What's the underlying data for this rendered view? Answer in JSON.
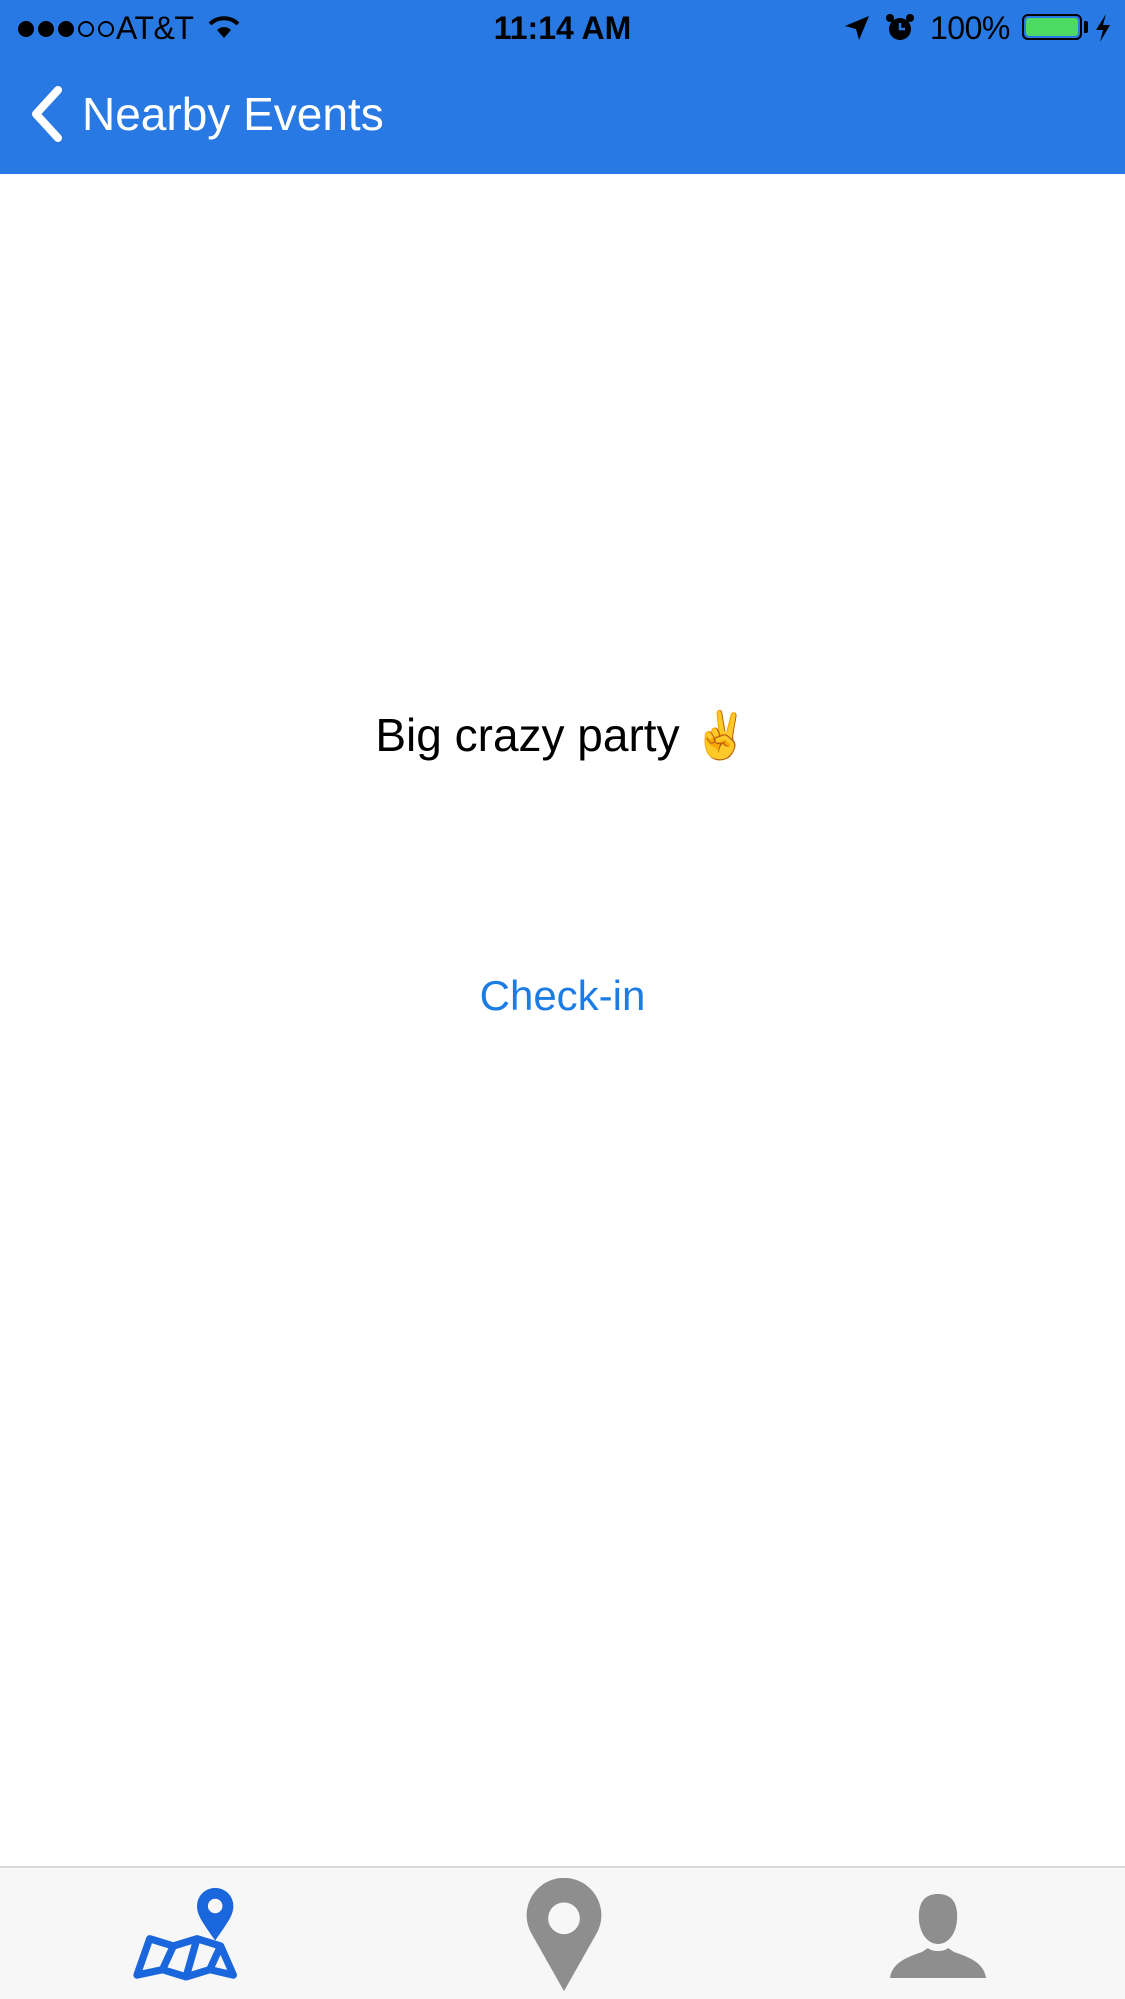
{
  "status_bar": {
    "signal_filled": 3,
    "signal_total": 5,
    "carrier": "AT&T",
    "time": "11:14 AM",
    "battery_percent": "100%",
    "battery_level": 1.0,
    "battery_color": "#4cd964",
    "icons": [
      "wifi-icon",
      "location-arrow-icon",
      "alarm-icon",
      "battery-icon",
      "charging-bolt-icon"
    ]
  },
  "nav": {
    "back_label": "Nearby Events",
    "bar_color": "#2879e3",
    "back_icon": "chevron-left-icon"
  },
  "main": {
    "event_title": "Big crazy party ✌️",
    "checkin_label": "Check-in",
    "link_color": "#1c7ce6"
  },
  "tabbar": {
    "tabs": [
      {
        "icon": "map-pin-icon",
        "selected": true,
        "color": "#1a66dc"
      },
      {
        "icon": "location-pin-icon",
        "selected": false,
        "color": "#8e8e8e"
      },
      {
        "icon": "profile-icon",
        "selected": false,
        "color": "#8e8e8e"
      }
    ]
  }
}
